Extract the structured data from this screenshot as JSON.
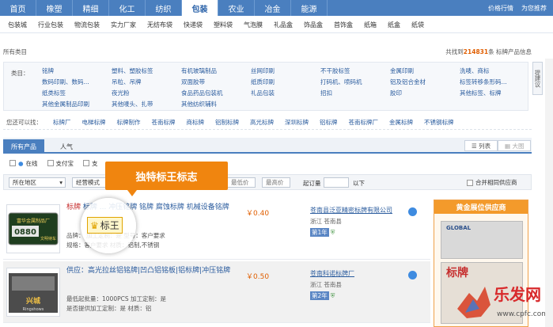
{
  "topnav": {
    "tabs": [
      "首页",
      "橡塑",
      "精细",
      "化工",
      "纺织",
      "包装",
      "农业",
      "冶金",
      "能源"
    ],
    "active_index": 5,
    "right": [
      "价格行情",
      "为您推荐"
    ]
  },
  "subnav": {
    "items": [
      "包装城",
      "行业包装",
      "物流包装",
      "实力厂家",
      "无纺布袋",
      "快递袋",
      "塑料袋",
      "气泡膜",
      "礼品盒",
      "饰品盒",
      "首饰盒",
      "纸箱",
      "纸盒",
      "纸袋"
    ]
  },
  "catbar": {
    "left": "所有类目",
    "right_prefix": "共找到",
    "count": "214831",
    "right_suffix": "条  标牌产品信息"
  },
  "categories": {
    "label": "类目：",
    "items": [
      "铭牌",
      "塑料、塑胶标签",
      "有机玻璃制品",
      "丝网印刷",
      "不干胶标签",
      "金属印刷",
      "洗唛、商标",
      "数码印刷、数码...",
      "吊粒、吊牌",
      "双面胶带",
      "纸质印刷",
      "打码机、喷码机",
      "铝及铝合金材",
      "标签转移条形码...",
      "纸类标签",
      "夜光粉",
      "食品药品包装机",
      "礼品包装",
      "招扣",
      "胶印",
      "其他标签、标牌",
      "其他金属制品印刷",
      "其他唛头、扎带",
      "其他纺织辅料"
    ]
  },
  "side_button": "提建议",
  "search_row": {
    "label": "您还可以找：",
    "items": [
      "标牌厂",
      "电梯标牌",
      "标牌制作",
      "苍南标牌",
      "商标牌",
      "铝制标牌",
      "高光标牌",
      "深圳标牌",
      "铝标牌",
      "苍南标牌厂",
      "金属标牌",
      "不锈钢标牌"
    ]
  },
  "tabs": {
    "active": "所有产品",
    "other": "人气",
    "view_list": "列表",
    "view_grid": "大图"
  },
  "filters": [
    "在线",
    "支付宝",
    "支"
  ],
  "select_row": {
    "region": "所在地区",
    "mode": "经营模式",
    "price_low": "最低价",
    "price_high": "最高价",
    "moq_label": "起订量",
    "moq_suffix": "以下",
    "merge": "合并相同供应商"
  },
  "callout": "独特标王标志",
  "lens_tag": "标王",
  "products": [
    {
      "title": "标牌 ... 冲压铭牌 铭牌 腐蚀标牌 机械设备铭牌",
      "spec1": "品牌：    加工定制：是    型号：客户要求",
      "spec2": "规格：客户要求    材质：铝制,不锈钢",
      "price": "￥0.40",
      "company": "苍南县泛亚精密标牌有限公司",
      "loc": "浙江  苍南县",
      "badge": "第1年",
      "plate": "0880"
    },
    {
      "title": "供应：高光拉丝铝铭牌|凹凸铝铭板|铝标牌|冲压铭牌",
      "spec1": "最低起批量：1000PCS    加工定制：是",
      "spec2": "是否提供加工定制：是    材质：铝",
      "price": "￥0.50",
      "company": "苍南科诺标牌厂",
      "loc": "浙江  苍南县",
      "badge": "第2年",
      "plate": "Ringshows"
    }
  ],
  "gold": {
    "header": "黄金展位供应商",
    "brand": "标牌",
    "sub": "GLOBAL"
  },
  "watermark": {
    "text": "乐发网",
    "url": "www.cpfc.com"
  }
}
